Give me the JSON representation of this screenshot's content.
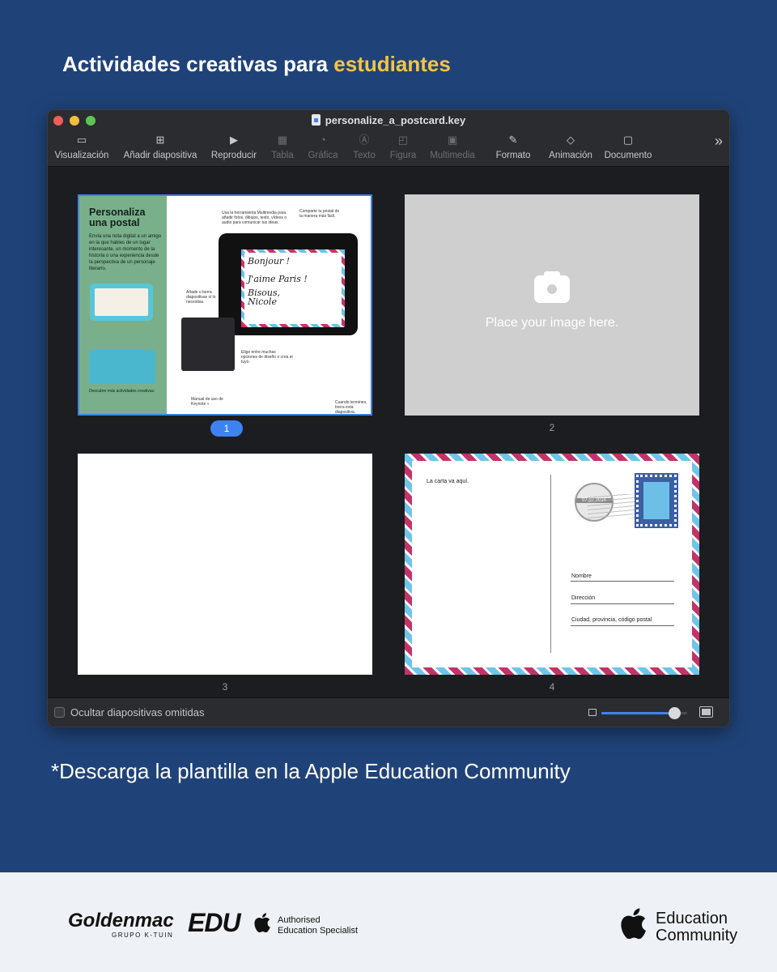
{
  "headline": {
    "prefix": "Actividades creativas para ",
    "accent": "estudiantes"
  },
  "window": {
    "title": "personalize_a_postcard.key",
    "toolbar": [
      {
        "label": "Visualización",
        "icon": "sidebar-icon",
        "enabled": true
      },
      {
        "label": "Añadir diapositiva",
        "icon": "add-slide-icon",
        "enabled": true
      },
      {
        "label": "Reproducir",
        "icon": "play-icon",
        "enabled": true
      },
      {
        "label": "Tabla",
        "icon": "table-icon",
        "enabled": false
      },
      {
        "label": "Gráfica",
        "icon": "chart-icon",
        "enabled": false
      },
      {
        "label": "Texto",
        "icon": "text-icon",
        "enabled": false
      },
      {
        "label": "Figura",
        "icon": "shape-icon",
        "enabled": false
      },
      {
        "label": "Multimedia",
        "icon": "media-icon",
        "enabled": false
      },
      {
        "label": "Formato",
        "icon": "format-brush-icon",
        "enabled": true
      },
      {
        "label": "Animación",
        "icon": "animation-icon",
        "enabled": true
      },
      {
        "label": "Documento",
        "icon": "document-icon",
        "enabled": true
      }
    ],
    "slides": [
      {
        "number": "1",
        "selected": true,
        "title": "Personaliza una postal",
        "body": "Envía una nota digital a un amigo en la que hables de un lugar interesante, un momento de la historia o una experiencia desde la perspectiva de un personaje literario.",
        "bottom_text": "Descubre más actividades creativas.",
        "note_multimedia": "Usa la herramienta Multimedia para añadir fotos, dibujos, texto, vídeos o audio para comunicar tus ideas.",
        "note_share": "Comparte tu postal de la manera más fácil.",
        "note_add": "Añade o borra diapositivas si lo necesitas.",
        "note_choose": "Elige entre muchas opciones de diseño o crea el tuyo.",
        "script_lines": [
          "Bonjour !",
          "J'aime Paris !",
          "Bisous, Nicole"
        ],
        "manual": "Manual de uso de Keynote »",
        "finish": "Cuando termines, borra esta diapositiva."
      },
      {
        "number": "2",
        "selected": false,
        "placeholder": "Place your image here."
      },
      {
        "number": "3",
        "selected": false
      },
      {
        "number": "4",
        "selected": false,
        "letter_label": "La carta va aquí.",
        "postmark_date": "07.07.2024",
        "fields": [
          "Nombre",
          "Dirección",
          "Ciudad, provincia, código postal"
        ]
      }
    ],
    "status": {
      "hide_skipped_label": "Ocultar diapositivas omitidas",
      "zoom_level": 0.85
    }
  },
  "caption": "*Descarga la plantilla en la Apple Education Community",
  "footer": {
    "goldenmac": "Goldenmac",
    "goldenmac_sub": "GRUPO K-TUIN",
    "edu": "EDU",
    "aes_line1": "Authorised",
    "aes_line2": "Education Specialist",
    "ec_line1": "Education",
    "ec_line2": "Community"
  },
  "colors": {
    "background": "#1f4379",
    "accent": "#f4c542",
    "selection": "#3d82f0"
  }
}
